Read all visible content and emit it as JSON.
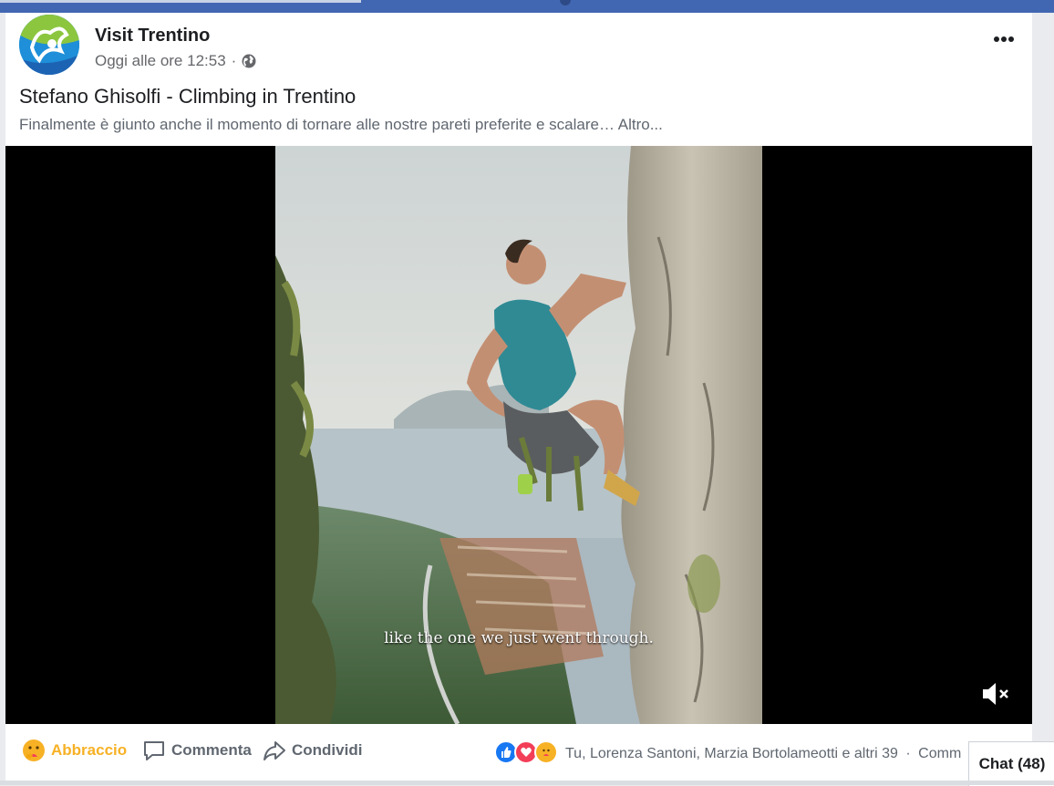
{
  "post": {
    "page_name": "Visit Trentino",
    "timestamp": "Oggi alle ore 12:53",
    "separator": "·",
    "audience_icon": "globe-icon",
    "more_icon": "more-dots-icon",
    "title": "Stefano Ghisolfi - Climbing in Trentino",
    "text": "Finalmente è giunto anche il momento di tornare alle nostre pareti preferite e scalare… Altro..."
  },
  "video": {
    "subtitle": "like the one we just went through.",
    "mute_icon": "volume-muted-icon"
  },
  "actions": {
    "react_label": "Abbraccio",
    "comment_label": "Commenta",
    "share_label": "Condividi"
  },
  "reactions": {
    "icons": [
      "like-icon",
      "love-icon",
      "care-icon"
    ],
    "summary": "Tu, Lorenza Santoni, Marzia Bortolameotti e altri 39",
    "separator": "·",
    "comments_link": "Comm"
  },
  "chat": {
    "label": "Chat (48)"
  },
  "colors": {
    "facebook_blue": "#4267b2",
    "reaction_active": "#f7b125",
    "text_secondary": "#606770",
    "like": "#1877f2",
    "love": "#f33e58"
  }
}
